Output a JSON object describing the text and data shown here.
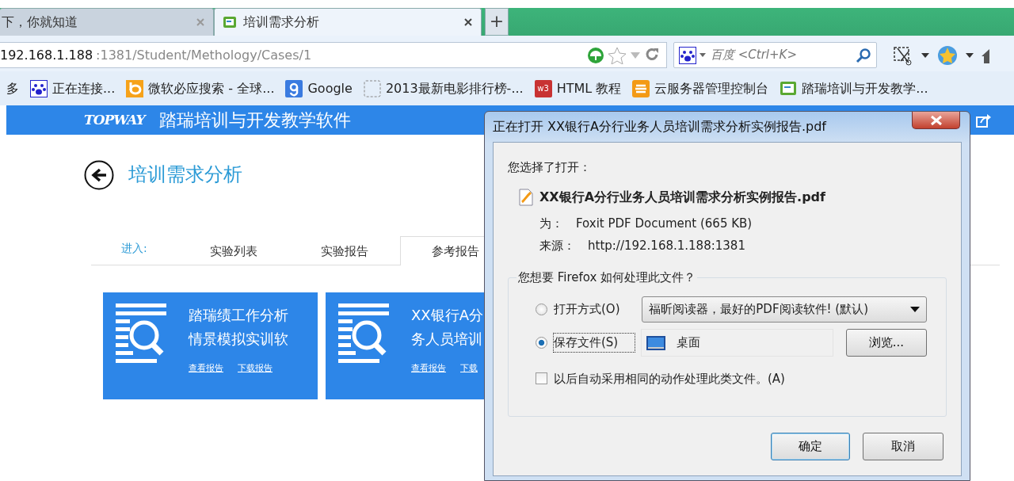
{
  "browser": {
    "tabs": [
      {
        "label": "下，你就知道",
        "selected": false
      },
      {
        "label": "培训需求分析",
        "selected": true
      }
    ],
    "new_tab": "+",
    "address": {
      "host": "192.168.1.188",
      "path": ":1381/Student/Methology/Cases/1"
    },
    "search": {
      "placeholder": "百度 <Ctrl+K>"
    },
    "bookmarks": [
      {
        "kind": "text",
        "label": "多"
      },
      {
        "kind": "paw",
        "label": "正在连接..."
      },
      {
        "kind": "bing",
        "label": "微软必应搜索 - 全球..."
      },
      {
        "kind": "google",
        "label": "Google"
      },
      {
        "kind": "blank",
        "label": "2013最新电影排行榜-..."
      },
      {
        "kind": "w3",
        "icon_text": "w3",
        "label": "HTML 教程"
      },
      {
        "kind": "cloud",
        "label": "云服务器管理控制台"
      },
      {
        "kind": "site",
        "label": "踏瑞培训与开发教学..."
      }
    ]
  },
  "header": {
    "logo_text": "TOPWAY",
    "title": "踏瑞培训与开发教学软件"
  },
  "page": {
    "title": "培训需求分析",
    "nav_label": "进入:",
    "tabs": [
      {
        "label": "实验列表",
        "selected": false
      },
      {
        "label": "实验报告",
        "selected": false
      },
      {
        "label": "参考报告",
        "selected": true
      }
    ],
    "cards": [
      {
        "title_lines": [
          "踏瑞绩工作分析",
          "情景模拟实训软"
        ],
        "links": [
          "查看报告",
          "下载报告"
        ]
      },
      {
        "title_lines": [
          "XX银行A分",
          "务人员培训"
        ],
        "links": [
          "查看报告",
          "下载"
        ]
      }
    ]
  },
  "dialog": {
    "title": "正在打开 XX银行A分行业务人员培训需求分析实例报告.pdf",
    "chosen_label": "您选择了打开：",
    "filename": "XX银行A分行业务人员培训需求分析实例报告.pdf",
    "type_label": "为：",
    "type_value": "Foxit PDF Document (665 KB)",
    "source_label": "来源：",
    "source_value": "http://192.168.1.188:1381",
    "group_label": "您想要 Firefox 如何处理此文件？",
    "options": [
      {
        "kind": "app",
        "label": "打开方式(O)",
        "selected": false,
        "value": "福昕阅读器，最好的PDF阅读软件! (默认)"
      },
      {
        "kind": "folder",
        "label": "保存文件(S)",
        "selected": true,
        "value": "桌面",
        "button": "浏览..."
      }
    ],
    "remember": {
      "label": "以后自动采用相同的动作处理此类文件。(A)",
      "checked": false
    },
    "buttons": [
      "确定",
      "取消"
    ]
  }
}
